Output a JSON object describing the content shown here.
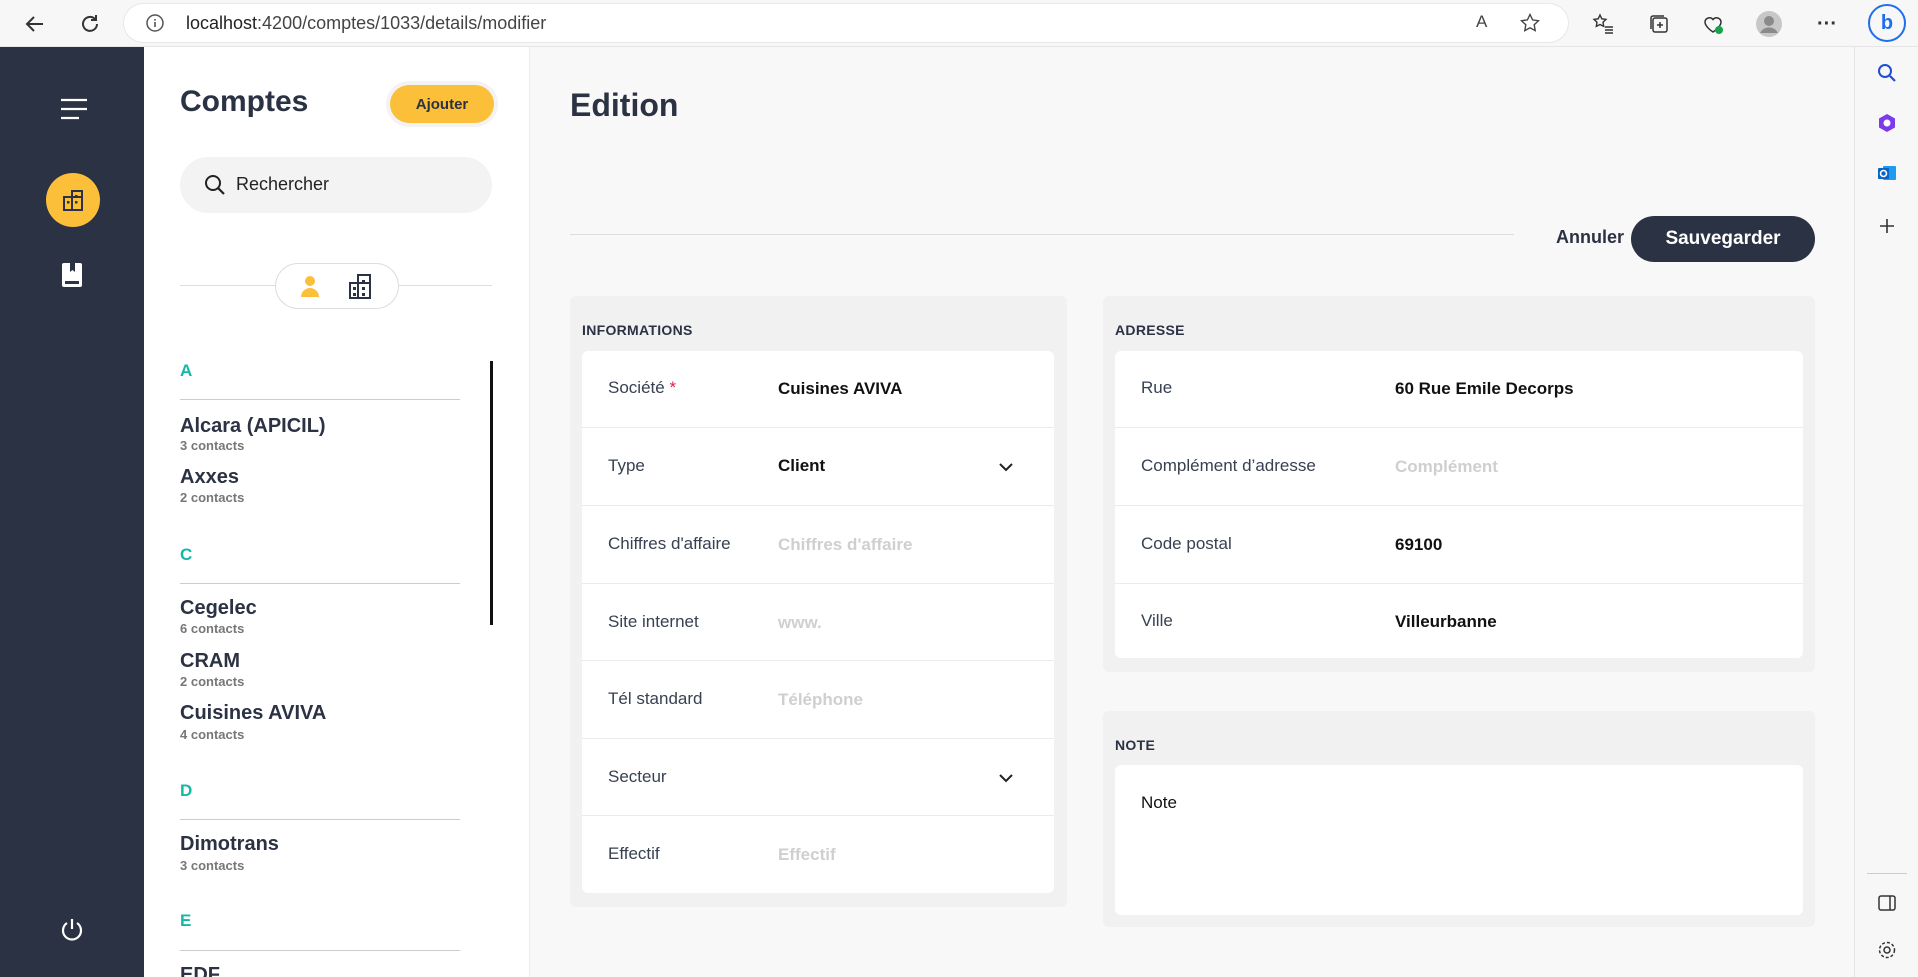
{
  "browser": {
    "url_host": "localhost",
    "url_path": ":4200/comptes/1033/details/modifier"
  },
  "list": {
    "title": "Comptes",
    "add_label": "Ajouter",
    "search_placeholder": "Rechercher",
    "groups": [
      {
        "letter": "A",
        "items": [
          {
            "name": "Alcara (APICIL)",
            "count": "3 contacts"
          },
          {
            "name": "Axxes",
            "count": "2 contacts"
          }
        ]
      },
      {
        "letter": "C",
        "items": [
          {
            "name": "Cegelec",
            "count": "6 contacts"
          },
          {
            "name": "CRAM",
            "count": "2 contacts"
          },
          {
            "name": "Cuisines AVIVA",
            "count": "4 contacts"
          }
        ]
      },
      {
        "letter": "D",
        "items": [
          {
            "name": "Dimotrans",
            "count": "3 contacts"
          }
        ]
      },
      {
        "letter": "E",
        "items": [
          {
            "name": "EDF",
            "count": ""
          }
        ]
      }
    ]
  },
  "main": {
    "title": "Edition",
    "cancel_label": "Annuler",
    "save_label": "Sauvegarder"
  },
  "informations": {
    "title": "INFORMATIONS",
    "rows": [
      {
        "label": "Société",
        "required": "*",
        "value": "Cuisines AVIVA",
        "placeholder": ""
      },
      {
        "label": "Type",
        "value": "Client",
        "placeholder": ""
      },
      {
        "label": "Chiffres d'affaire",
        "value": "",
        "placeholder": "Chiffres d'affaire"
      },
      {
        "label": "Site internet",
        "value": "",
        "placeholder": "www."
      },
      {
        "label": "Tél standard",
        "value": "",
        "placeholder": "Téléphone"
      },
      {
        "label": "Secteur",
        "value": "",
        "placeholder": ""
      },
      {
        "label": "Effectif",
        "value": "",
        "placeholder": "Effectif"
      }
    ]
  },
  "adresse": {
    "title": "ADRESSE",
    "rows": [
      {
        "label": "Rue",
        "value": "60 Rue Emile Decorps",
        "placeholder": ""
      },
      {
        "label": "Complément d’adresse",
        "value": "",
        "placeholder": "Complément"
      },
      {
        "label": "Code postal",
        "value": "69100",
        "placeholder": ""
      },
      {
        "label": "Ville",
        "value": "Villeurbanne",
        "placeholder": ""
      }
    ]
  },
  "note": {
    "title": "NOTE",
    "placeholder": "Note"
  },
  "colors": {
    "sidebar": "#2b3243",
    "accent": "#fbbf3a",
    "letter": "#14b8a6"
  }
}
